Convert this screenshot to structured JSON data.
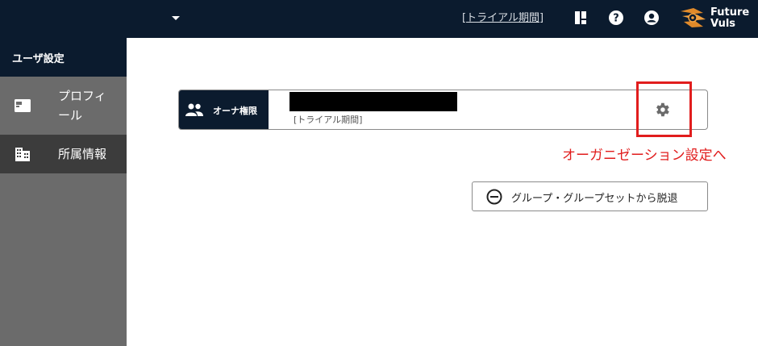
{
  "header": {
    "trial_link": "[トライアル期間]",
    "logo_text": [
      "Future",
      "Vuls"
    ]
  },
  "sidebar": {
    "title": "ユーザ設定",
    "items": [
      {
        "label_line1": "プロフィ",
        "label_line2": "ール",
        "icon": "id-card-icon"
      },
      {
        "label": "所属情報",
        "icon": "building-icon"
      }
    ]
  },
  "main": {
    "card": {
      "role_label": "オーナ権限",
      "subtitle": "[トライアル期間]"
    },
    "annotation": "オーガニゼーション設定へ",
    "leave_button": "グループ・グループセットから脱退"
  },
  "colors": {
    "nav_bg": "#0b1b2e",
    "sidebar_bg": "#6b6b6b",
    "sidebar_active_bg": "#3c3c3c",
    "annotation": "#e11d1d"
  }
}
